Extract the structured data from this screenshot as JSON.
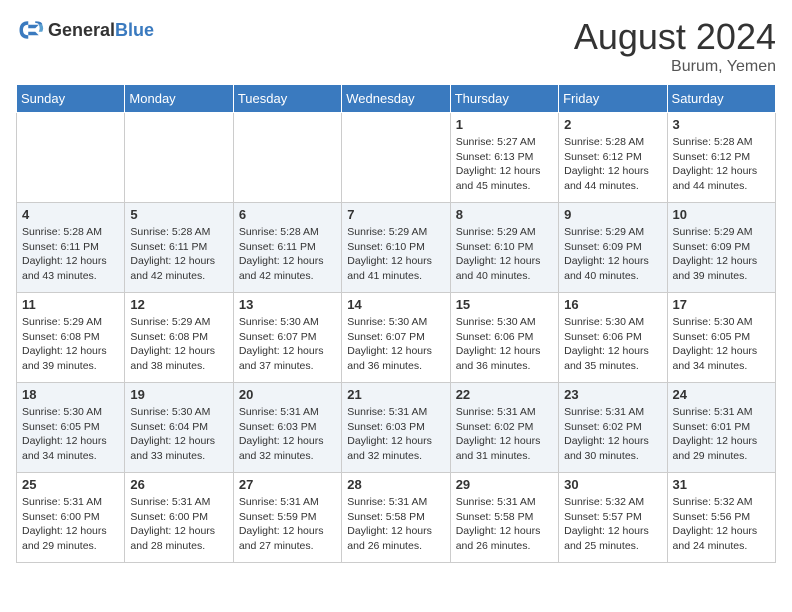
{
  "header": {
    "logo_general": "General",
    "logo_blue": "Blue",
    "month_year": "August 2024",
    "location": "Burum, Yemen"
  },
  "days_of_week": [
    "Sunday",
    "Monday",
    "Tuesday",
    "Wednesday",
    "Thursday",
    "Friday",
    "Saturday"
  ],
  "weeks": [
    [
      {
        "day": "",
        "sunrise": "",
        "sunset": "",
        "daylight": ""
      },
      {
        "day": "",
        "sunrise": "",
        "sunset": "",
        "daylight": ""
      },
      {
        "day": "",
        "sunrise": "",
        "sunset": "",
        "daylight": ""
      },
      {
        "day": "",
        "sunrise": "",
        "sunset": "",
        "daylight": ""
      },
      {
        "day": "1",
        "sunrise": "5:27 AM",
        "sunset": "6:13 PM",
        "daylight": "12 hours and 45 minutes."
      },
      {
        "day": "2",
        "sunrise": "5:28 AM",
        "sunset": "6:12 PM",
        "daylight": "12 hours and 44 minutes."
      },
      {
        "day": "3",
        "sunrise": "5:28 AM",
        "sunset": "6:12 PM",
        "daylight": "12 hours and 44 minutes."
      }
    ],
    [
      {
        "day": "4",
        "sunrise": "5:28 AM",
        "sunset": "6:11 PM",
        "daylight": "12 hours and 43 minutes."
      },
      {
        "day": "5",
        "sunrise": "5:28 AM",
        "sunset": "6:11 PM",
        "daylight": "12 hours and 42 minutes."
      },
      {
        "day": "6",
        "sunrise": "5:28 AM",
        "sunset": "6:11 PM",
        "daylight": "12 hours and 42 minutes."
      },
      {
        "day": "7",
        "sunrise": "5:29 AM",
        "sunset": "6:10 PM",
        "daylight": "12 hours and 41 minutes."
      },
      {
        "day": "8",
        "sunrise": "5:29 AM",
        "sunset": "6:10 PM",
        "daylight": "12 hours and 40 minutes."
      },
      {
        "day": "9",
        "sunrise": "5:29 AM",
        "sunset": "6:09 PM",
        "daylight": "12 hours and 40 minutes."
      },
      {
        "day": "10",
        "sunrise": "5:29 AM",
        "sunset": "6:09 PM",
        "daylight": "12 hours and 39 minutes."
      }
    ],
    [
      {
        "day": "11",
        "sunrise": "5:29 AM",
        "sunset": "6:08 PM",
        "daylight": "12 hours and 39 minutes."
      },
      {
        "day": "12",
        "sunrise": "5:29 AM",
        "sunset": "6:08 PM",
        "daylight": "12 hours and 38 minutes."
      },
      {
        "day": "13",
        "sunrise": "5:30 AM",
        "sunset": "6:07 PM",
        "daylight": "12 hours and 37 minutes."
      },
      {
        "day": "14",
        "sunrise": "5:30 AM",
        "sunset": "6:07 PM",
        "daylight": "12 hours and 36 minutes."
      },
      {
        "day": "15",
        "sunrise": "5:30 AM",
        "sunset": "6:06 PM",
        "daylight": "12 hours and 36 minutes."
      },
      {
        "day": "16",
        "sunrise": "5:30 AM",
        "sunset": "6:06 PM",
        "daylight": "12 hours and 35 minutes."
      },
      {
        "day": "17",
        "sunrise": "5:30 AM",
        "sunset": "6:05 PM",
        "daylight": "12 hours and 34 minutes."
      }
    ],
    [
      {
        "day": "18",
        "sunrise": "5:30 AM",
        "sunset": "6:05 PM",
        "daylight": "12 hours and 34 minutes."
      },
      {
        "day": "19",
        "sunrise": "5:30 AM",
        "sunset": "6:04 PM",
        "daylight": "12 hours and 33 minutes."
      },
      {
        "day": "20",
        "sunrise": "5:31 AM",
        "sunset": "6:03 PM",
        "daylight": "12 hours and 32 minutes."
      },
      {
        "day": "21",
        "sunrise": "5:31 AM",
        "sunset": "6:03 PM",
        "daylight": "12 hours and 32 minutes."
      },
      {
        "day": "22",
        "sunrise": "5:31 AM",
        "sunset": "6:02 PM",
        "daylight": "12 hours and 31 minutes."
      },
      {
        "day": "23",
        "sunrise": "5:31 AM",
        "sunset": "6:02 PM",
        "daylight": "12 hours and 30 minutes."
      },
      {
        "day": "24",
        "sunrise": "5:31 AM",
        "sunset": "6:01 PM",
        "daylight": "12 hours and 29 minutes."
      }
    ],
    [
      {
        "day": "25",
        "sunrise": "5:31 AM",
        "sunset": "6:00 PM",
        "daylight": "12 hours and 29 minutes."
      },
      {
        "day": "26",
        "sunrise": "5:31 AM",
        "sunset": "6:00 PM",
        "daylight": "12 hours and 28 minutes."
      },
      {
        "day": "27",
        "sunrise": "5:31 AM",
        "sunset": "5:59 PM",
        "daylight": "12 hours and 27 minutes."
      },
      {
        "day": "28",
        "sunrise": "5:31 AM",
        "sunset": "5:58 PM",
        "daylight": "12 hours and 26 minutes."
      },
      {
        "day": "29",
        "sunrise": "5:31 AM",
        "sunset": "5:58 PM",
        "daylight": "12 hours and 26 minutes."
      },
      {
        "day": "30",
        "sunrise": "5:32 AM",
        "sunset": "5:57 PM",
        "daylight": "12 hours and 25 minutes."
      },
      {
        "day": "31",
        "sunrise": "5:32 AM",
        "sunset": "5:56 PM",
        "daylight": "12 hours and 24 minutes."
      }
    ]
  ]
}
